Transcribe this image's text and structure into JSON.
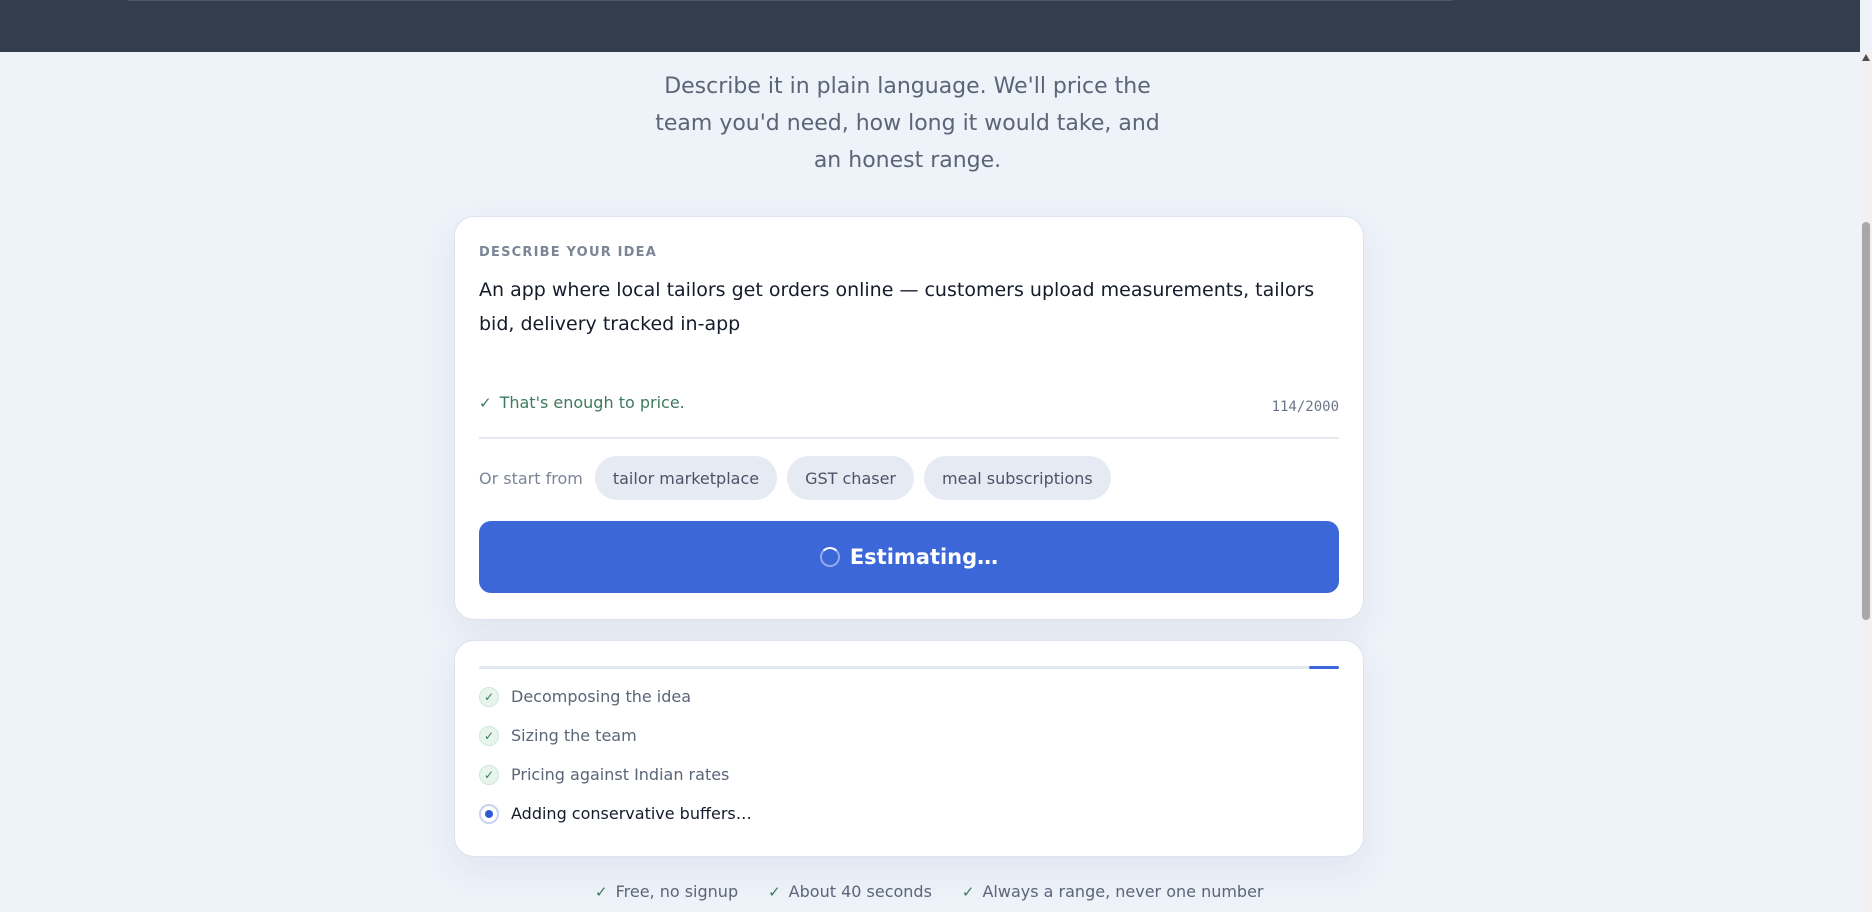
{
  "header": {},
  "hero": {
    "subtitle": "Describe it in plain language. We'll price the team you'd need, how long it would take, and an honest range."
  },
  "idea_card": {
    "label": "DESCRIBE YOUR IDEA",
    "idea_text": "An app where local tailors get orders online — customers upload measurements, tailors bid, delivery tracked in-app",
    "validation": "That's enough to price.",
    "char_count": "114/2000",
    "start_label": "Or start from",
    "chips": [
      "tailor marketplace",
      "GST chaser",
      "meal subscriptions"
    ],
    "button_label": "Estimating…"
  },
  "progress": {
    "fill_start": 0.965,
    "fill_end": 1.0,
    "steps": [
      {
        "label": "Decomposing the idea",
        "state": "done"
      },
      {
        "label": "Sizing the team",
        "state": "done"
      },
      {
        "label": "Pricing against Indian rates",
        "state": "done"
      },
      {
        "label": "Adding conservative buffers…",
        "state": "active"
      }
    ]
  },
  "footer": {
    "items": [
      "Free, no signup",
      "About 40 seconds",
      "Always a range, never one number"
    ]
  },
  "colors": {
    "accent": "#3b67d9",
    "success": "#3d7a5f",
    "background": "#eef2f9",
    "topbar": "#343d4d"
  },
  "icons": {
    "check": "check-icon",
    "spinner": "spinner-icon",
    "active_step": "active-dot-icon"
  }
}
